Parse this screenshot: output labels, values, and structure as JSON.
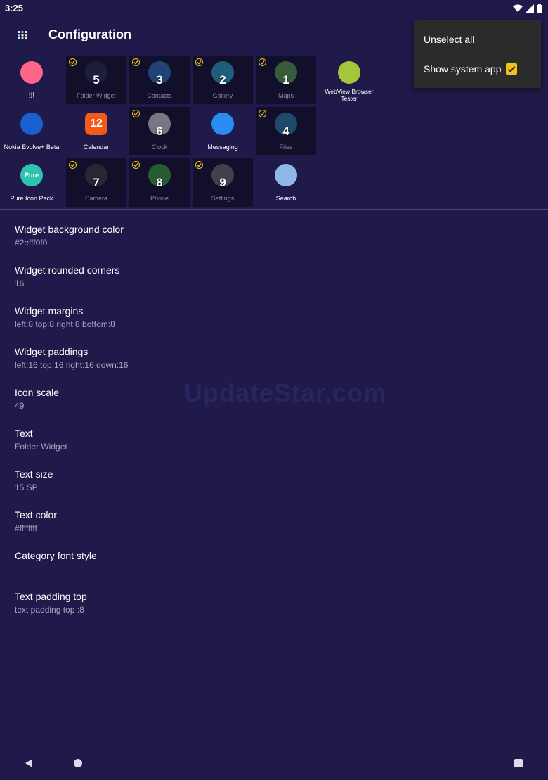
{
  "status": {
    "time": "3:25"
  },
  "toolbar": {
    "title": "Configuration"
  },
  "grid": [
    {
      "label": "洪",
      "selected": false,
      "number": "",
      "color": "#ff6688"
    },
    {
      "label": "Folder Widget",
      "selected": true,
      "number": "5",
      "color": "#2b2b44"
    },
    {
      "label": "Contacts",
      "selected": true,
      "number": "3",
      "color": "#2f6fb3"
    },
    {
      "label": "Gallery",
      "selected": true,
      "number": "2",
      "color": "#2aa0c0"
    },
    {
      "label": "Maps",
      "selected": true,
      "number": "1",
      "color": "#5a9a4a"
    },
    {
      "label": "WebView Browser Tester",
      "selected": false,
      "number": "",
      "color": "#a4c639"
    },
    {
      "label": "Nokia Evolve+ Beta",
      "selected": false,
      "number": "",
      "color": "#1a5fd0"
    },
    {
      "label": "Calendar",
      "selected": false,
      "number": "",
      "color": "#f25a1c",
      "glyph": "12"
    },
    {
      "label": "Clock",
      "selected": true,
      "number": "6",
      "color": "#cccccc"
    },
    {
      "label": "Messaging",
      "selected": false,
      "number": "",
      "color": "#2a8cf0"
    },
    {
      "label": "Files",
      "selected": true,
      "number": "4",
      "color": "#2a7a9a"
    },
    {
      "label": "Pure Icon Pack",
      "selected": false,
      "number": "",
      "color": "#2ec4b0",
      "glyph": "Pure"
    },
    {
      "label": "Camera",
      "selected": true,
      "number": "7",
      "color": "#3a3a3a"
    },
    {
      "label": "Phone",
      "selected": true,
      "number": "8",
      "color": "#3a9a3a"
    },
    {
      "label": "Settings",
      "selected": true,
      "number": "9",
      "color": "#6a6a6a"
    },
    {
      "label": "Search",
      "selected": false,
      "number": "",
      "color": "#8fb8e8"
    }
  ],
  "settings": [
    {
      "title": "Widget background color",
      "value": "#2efff0f0"
    },
    {
      "title": "Widget rounded corners",
      "value": "16"
    },
    {
      "title": "Widget margins",
      "value": "left:8 top:8 right:8 bottom:8"
    },
    {
      "title": "Widget paddings",
      "value": "left:16 top:16 right:16 down:16"
    },
    {
      "title": "Icon scale",
      "value": "49"
    },
    {
      "title": "Text",
      "value": "Folder Widget"
    },
    {
      "title": "Text size",
      "value": "15 SP"
    },
    {
      "title": "Text color",
      "value": "#ffffffff"
    },
    {
      "title": "Category font style",
      "value": ""
    },
    {
      "title": "Text padding top",
      "value": "text padding top :8"
    }
  ],
  "watermark": "UpdateStar.com",
  "popup": {
    "unselect_all": "Unselect all",
    "show_system_app": "Show system app",
    "show_system_app_checked": true
  }
}
